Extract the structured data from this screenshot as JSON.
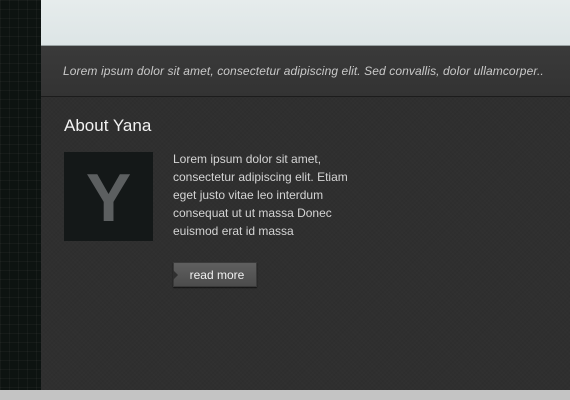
{
  "header": {
    "tagline": "Lorem ipsum dolor sit amet, consectetur adipiscing elit. Sed convallis, dolor ullamcorper.."
  },
  "about": {
    "title": "About Yana",
    "avatar_letter": "Y",
    "bio": "Lorem ipsum dolor sit amet, consectetur adipiscing elit. Etiam eget justo vitae leo interdum consequat ut ut massa Donec euismod erat id massa",
    "read_more_label": "read more"
  },
  "colors": {
    "content_background": "#2f2f2f",
    "top_band": "#e3e9e9",
    "avatar_background": "#141818",
    "button": "#555555"
  }
}
